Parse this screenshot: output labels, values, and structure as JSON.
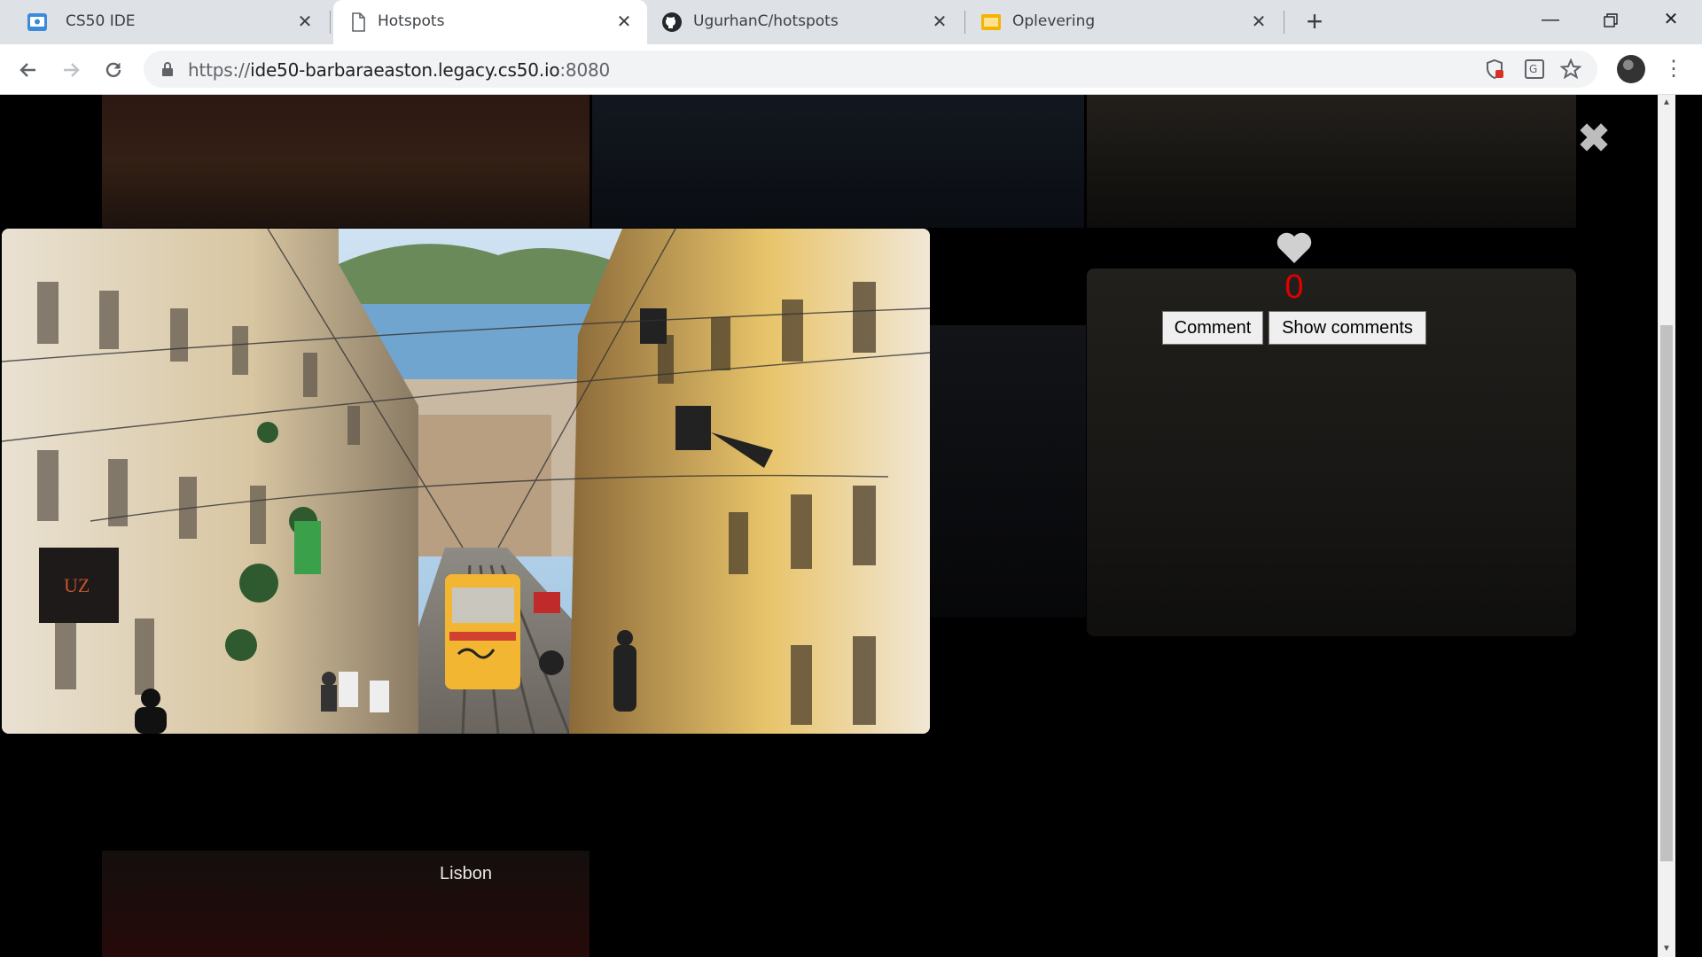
{
  "browser": {
    "tabs": [
      {
        "title": "CS50 IDE",
        "icon": "cs50-ide-icon",
        "active": false
      },
      {
        "title": "Hotspots",
        "icon": "page-icon",
        "active": true
      },
      {
        "title": "UgurhanC/hotspots",
        "icon": "github-icon",
        "active": false
      },
      {
        "title": "Oplevering",
        "icon": "slides-icon",
        "active": false
      }
    ],
    "url": {
      "scheme": "https://",
      "host": "ide50-barbaraeaston.legacy.cs50.io",
      "port": ":8080"
    }
  },
  "page": {
    "photo_caption": "Lisbon",
    "likes": "0",
    "comment_label": "Comment",
    "show_comments_label": "Show comments",
    "accent_like_color": "#e00000"
  }
}
